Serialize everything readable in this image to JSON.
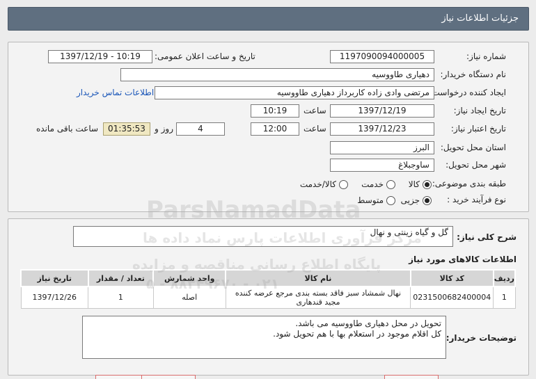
{
  "header": {
    "title": "جزئیات اطلاعات نیاز"
  },
  "form": {
    "need_number": {
      "label": "شماره نیاز:",
      "value": "1197090094000005"
    },
    "announce": {
      "label": "تاریخ و ساعت اعلان عمومی:",
      "value": "1397/12/19 - 10:19"
    },
    "buyer_org": {
      "label": "نام دستگاه خریدار:",
      "value": "دهیاری طاووسیه"
    },
    "requester": {
      "label": "ایجاد کننده درخواست:",
      "value": "مرتضی وادی زاده کاربرداز دهیاری طاووسیه"
    },
    "contact_link": "اطلاعات تماس خریدار",
    "created": {
      "label": "تاریخ ایجاد نیاز:",
      "date": "1397/12/19",
      "time_label": "ساعت",
      "time": "10:19"
    },
    "validity": {
      "label": "تاریخ اعتبار نیاز:",
      "date": "1397/12/23",
      "time_label": "ساعت",
      "time": "12:00",
      "days": "4",
      "days_label": "روز و",
      "remaining": "01:35:53",
      "remaining_label": "ساعت باقی مانده"
    },
    "province": {
      "label": "استان محل تحویل:",
      "value": "البرز"
    },
    "city": {
      "label": "شهر محل تحویل:",
      "value": "ساوجبلاغ"
    },
    "category": {
      "label": "طبقه بندی موضوعی:",
      "options": [
        "کالا",
        "خدمت",
        "کالا/خدمت"
      ],
      "selected": "کالا"
    },
    "purchase_type": {
      "label": "نوع فرآیند خرید :",
      "options": [
        "جزیی",
        "متوسط"
      ],
      "selected": "جزیی"
    }
  },
  "summary": {
    "label": "شرح کلی نیاز:",
    "value": "گل و گیاه زینتی و نهال"
  },
  "goods": {
    "title": "اطلاعات کالاهای مورد نیاز",
    "columns": [
      "ردیف",
      "کد کالا",
      "نام کالا",
      "واحد شمارش",
      "تعداد / مقدار",
      "تاریخ نیاز"
    ],
    "rows": [
      [
        "1",
        "0231500682400004",
        "نهال شمشاد سبز فاقد بسته بندی مرجع عرضه کننده مجید قندهاری",
        "اصله",
        "1",
        "1397/12/26"
      ]
    ]
  },
  "buyer_notes": {
    "label": "توضیحات خریدار:",
    "lines": [
      "تحویل در محل دهیاری طاووسیه می باشد.",
      "کل اقلام موجود در  استعلام بها با هم تحویل شود."
    ]
  },
  "watermarks": {
    "brand": "ParsNamadData",
    "line1": "مرکز فرآوری اطلاعات پارس نماد داده ها",
    "line2": "پایگاه اطلاع رسانی مناقصه و مزایده",
    "phone": "۰۲۱ - ۸۸۳۴۹۶۷۰ - ۵"
  }
}
